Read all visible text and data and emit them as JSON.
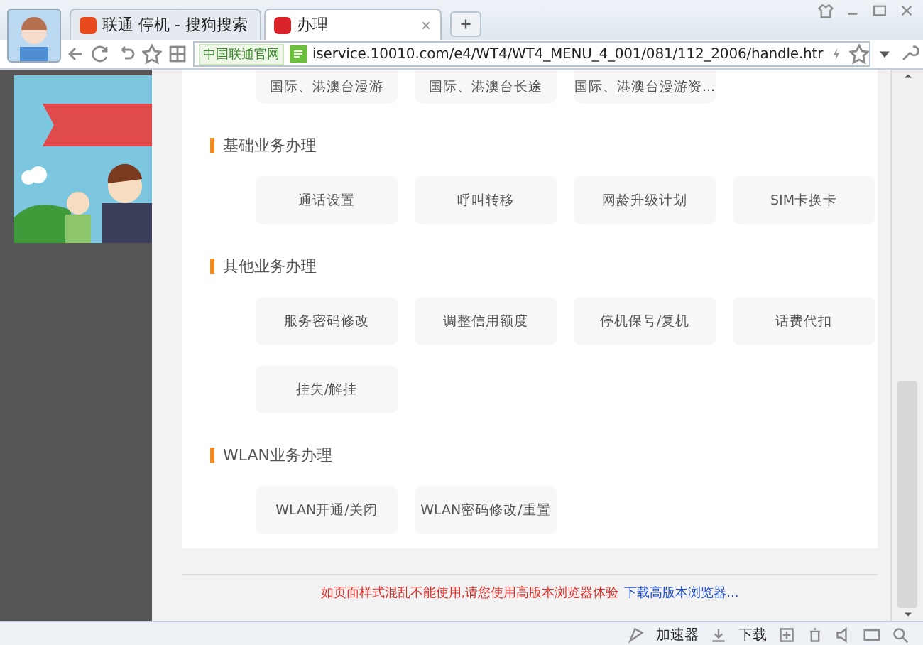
{
  "browser": {
    "tabs": [
      {
        "label": "联通 停机 - 搜狗搜索",
        "selected": false
      },
      {
        "label": "办理",
        "selected": true
      }
    ],
    "address": {
      "site_badge": "中国联通官网",
      "url": "iservice.10010.com/e4/WT4/WT4_MENU_4_001/081/112_2006/handle.htr"
    }
  },
  "top_buttons": [
    "国际、港澳台漫游",
    "国际、港澳台长途",
    "国际、港澳台漫游资..."
  ],
  "sections": [
    {
      "title": "基础业务办理",
      "buttons": [
        "通话设置",
        "呼叫转移",
        "网龄升级计划",
        "SIM卡换卡"
      ]
    },
    {
      "title": "其他业务办理",
      "buttons": [
        "服务密码修改",
        "调整信用额度",
        "停机保号/复机",
        "话费代扣",
        "挂失/解挂"
      ]
    },
    {
      "title": "WLAN业务办理",
      "buttons": [
        "WLAN开通/关闭",
        "WLAN密码修改/重置"
      ]
    }
  ],
  "footer": {
    "notice": "如页面样式混乱不能使用,请您使用高版本浏览器体验",
    "link": "下载高版本浏览器..."
  },
  "status_bar": {
    "accelerator": "加速器",
    "download": "下载"
  }
}
